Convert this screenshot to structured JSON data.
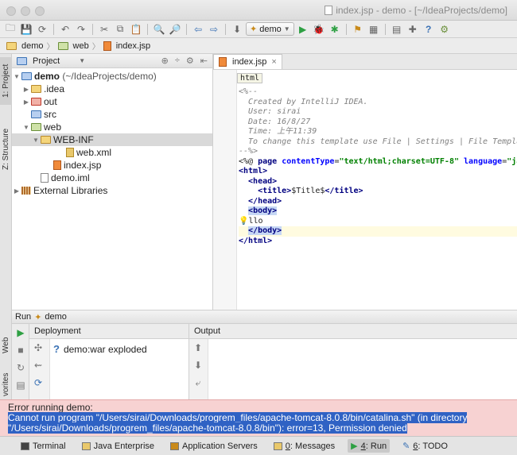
{
  "window": {
    "title": "index.jsp - demo - [~/IdeaProjects/demo]"
  },
  "toolbar": {
    "run_config": "demo"
  },
  "breadcrumb": [
    "demo",
    "web",
    "index.jsp"
  ],
  "left_strip": {
    "project_tab": "1: Project",
    "structure_tab": "Z: Structure",
    "web_tab": "Web",
    "favorites_tab": "vorites"
  },
  "project_panel": {
    "title": "Project",
    "tree": {
      "root_name": "demo",
      "root_path": "(~/IdeaProjects/demo)",
      "idea": ".idea",
      "out": "out",
      "src": "src",
      "web": "web",
      "webinf": "WEB-INF",
      "webxml": "web.xml",
      "indexjsp": "index.jsp",
      "demoiml": "demo.iml",
      "extlibs": "External Libraries"
    }
  },
  "editor": {
    "tab_label": "index.jsp",
    "breadcrumb_tag": "html",
    "lines": {
      "l1": "<%--",
      "l2": "  Created by IntelliJ IDEA.",
      "l3": "  User: sirai",
      "l4": "  Date: 16/8/27",
      "l5": "  Time: 上午11:39",
      "l6": "  To change this template use File | Settings | File Templat",
      "l7": "--%>",
      "l8a": "<%@ ",
      "l8b": "page ",
      "l8c": "contentType",
      "l8d": "=",
      "l8e": "\"text/html;charset=UTF-8\"",
      "l8f": " ",
      "l8g": "language",
      "l8h": "=",
      "l8i": "\"jav",
      "l9": "<html>",
      "l10": "  <head>",
      "l11a": "    <title>",
      "l11b": "$Title$",
      "l11c": "</title>",
      "l12": "  </head>",
      "l13": "<body>",
      "l14": "llo",
      "l15": "</body>",
      "l16": "</html>"
    }
  },
  "run_panel": {
    "title": "Run",
    "config": "demo",
    "deployment_header": "Deployment",
    "output_header": "Output",
    "deploy_item": "demo:war exploded"
  },
  "error": {
    "heading": "Error running demo:",
    "line1": "Cannot run program \"/Users/sirai/Downloads/progrem_files/apache-tomcat-8.0.8/bin/catalina.sh\" (in directory",
    "line2": "\"/Users/sirai/Downloads/progrem_files/apache-tomcat-8.0.8/bin\"): error=13, Permission denied"
  },
  "bottom_tabs": {
    "terminal": "Terminal",
    "java_enterprise": "Java Enterprise",
    "app_servers": "Application Servers",
    "messages_num": "0",
    "messages_text": ": Messages",
    "run_num": "4",
    "run_text": ": Run",
    "todo_num": "6",
    "todo_text": ": TODO"
  },
  "colors": {
    "error_bg": "#f7d2d2",
    "selection": "#2f62c4",
    "run_green": "#2ea043"
  }
}
